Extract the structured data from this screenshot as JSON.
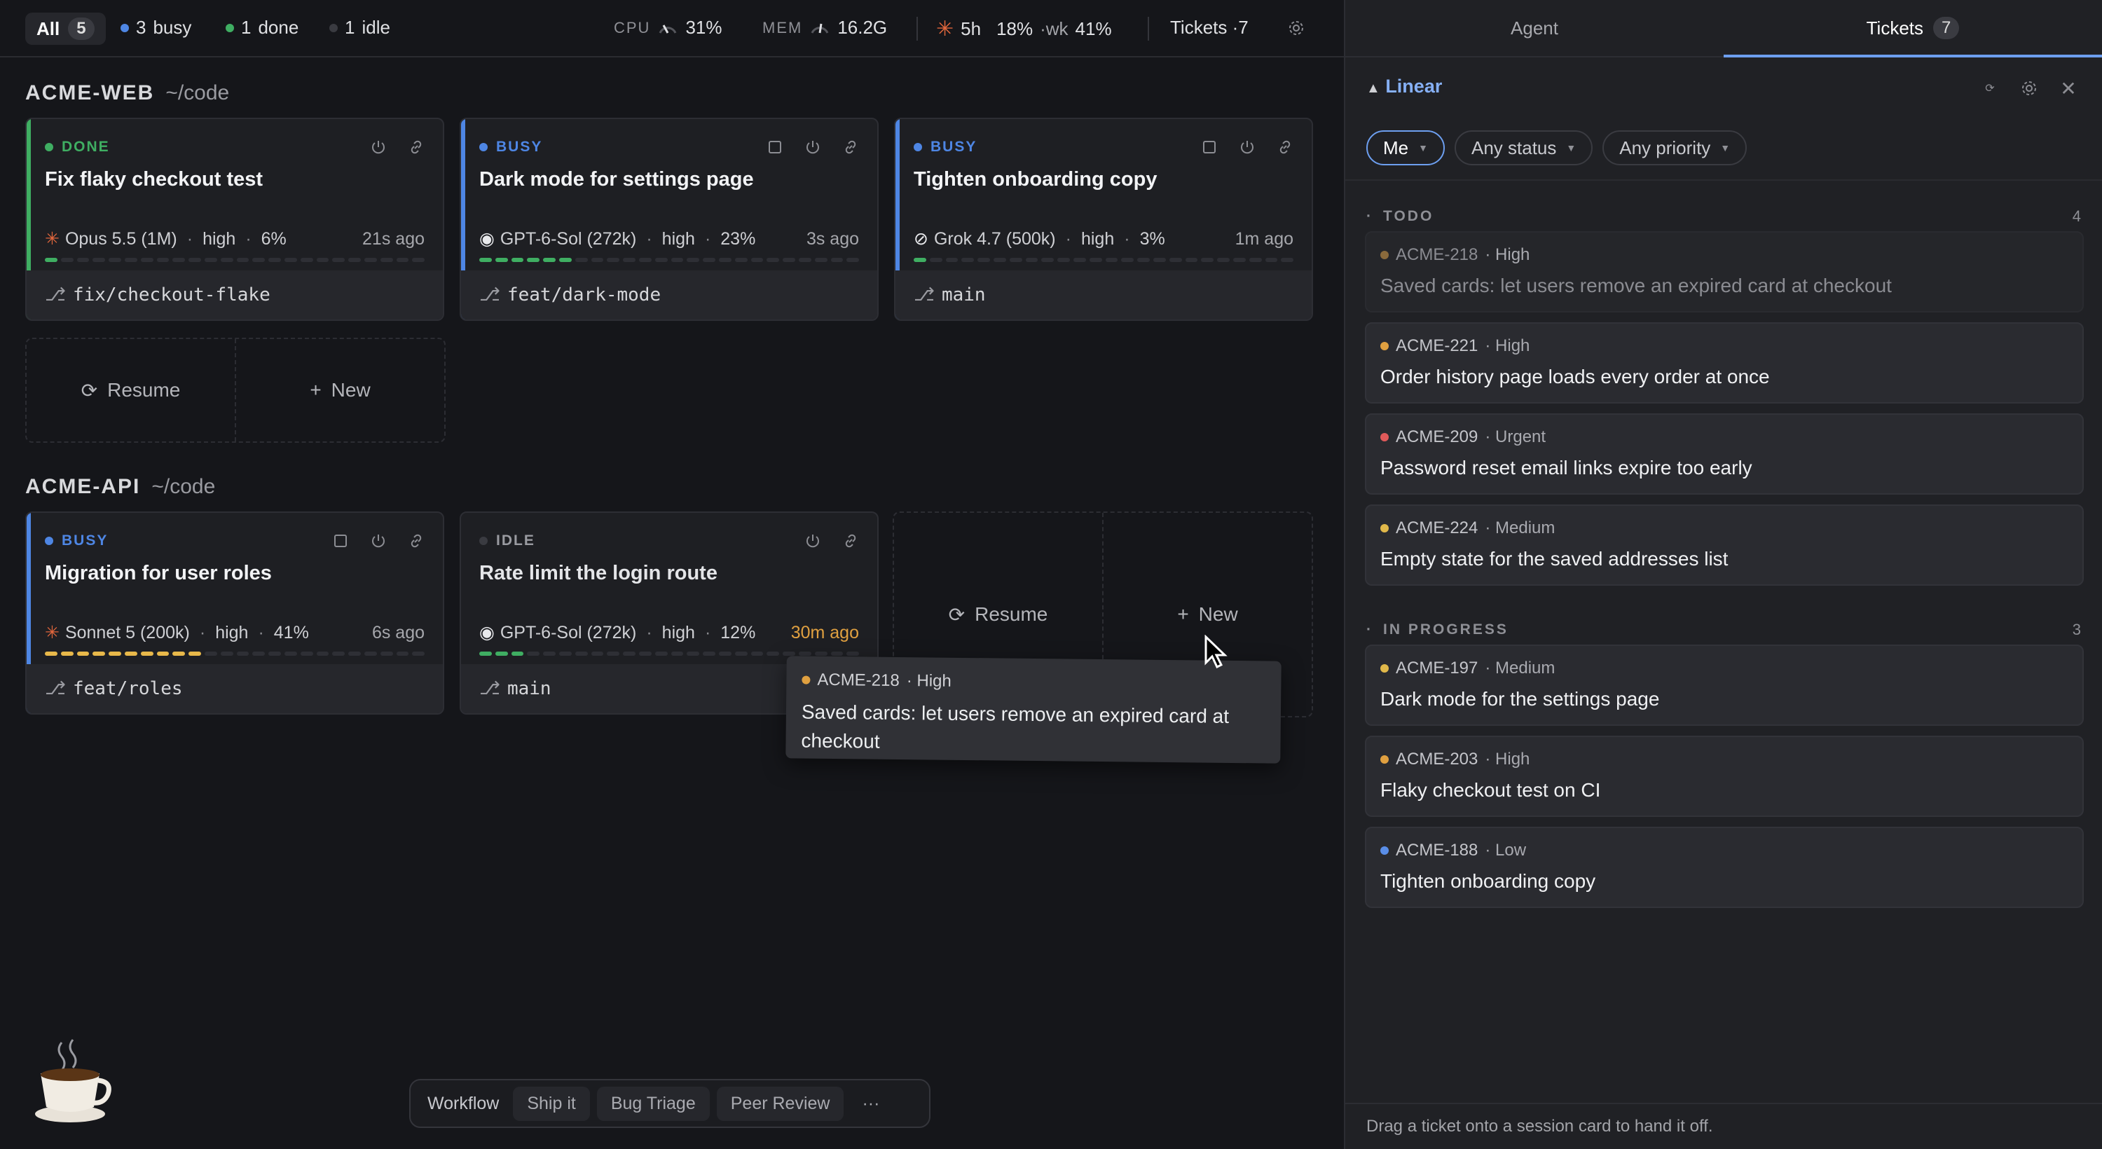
{
  "topbar": {
    "all_label": "All",
    "all_count": "5",
    "busy": {
      "count": "3",
      "label": "busy",
      "color": "#4e86e4"
    },
    "done": {
      "count": "1",
      "label": "done",
      "color": "#3fae62"
    },
    "idle": {
      "count": "1",
      "label": "idle",
      "color": "#55565c"
    },
    "cpu_label": "CPU",
    "cpu_value": "31%",
    "mem_label": "MEM",
    "mem_value": "16.2G",
    "usage_window": "5h",
    "usage_5h": "18%",
    "usage_wk_label": "·wk",
    "usage_wk": "41%",
    "tickets_label": "Tickets ·7"
  },
  "groups": [
    {
      "name": "ACME-WEB",
      "path": "~/code",
      "cards": [
        {
          "status": "DONE",
          "status_color": "#3fae62",
          "title": "Fix flaky checkout test",
          "model": "Opus 5.5 (1M)",
          "effort": "high",
          "percent": "6%",
          "ago": "21s ago",
          "branch": "fix/checkout-flake"
        },
        {
          "status": "BUSY",
          "status_color": "#4e86e4",
          "title": "Dark mode for settings page",
          "model": "GPT-6-Sol (272k)",
          "effort": "high",
          "percent": "23%",
          "ago": "3s ago",
          "branch": "feat/dark-mode"
        },
        {
          "status": "BUSY",
          "status_color": "#4e86e4",
          "title": "Tighten onboarding copy",
          "model": "Grok 4.7 (500k)",
          "effort": "high",
          "percent": "3%",
          "ago": "1m ago",
          "branch": "main"
        }
      ]
    },
    {
      "name": "ACME-API",
      "path": "~/code",
      "cards": [
        {
          "status": "BUSY",
          "status_color": "#4e86e4",
          "title": "Migration for user roles",
          "model": "Sonnet 5 (200k)",
          "effort": "high",
          "percent": "41%",
          "ago": "6s ago",
          "branch": "feat/roles"
        },
        {
          "status": "IDLE",
          "status_color": "#55565c",
          "title": "Rate limit the login route",
          "model": "GPT-6-Sol (272k)",
          "effort": "high",
          "percent": "12%",
          "ago": "30m ago",
          "branch": "main"
        }
      ]
    }
  ],
  "ghost_actions": {
    "resume": "Resume",
    "new": "New"
  },
  "drag_ghost": {
    "id": "ACME-218",
    "priority": "· High",
    "title": "Saved cards: let users remove an expired card at checkout"
  },
  "bottombar": {
    "workflow": "Workflow",
    "chips": [
      "Ship it",
      "Bug Triage",
      "Peer Review"
    ],
    "more": "···"
  },
  "panel": {
    "tabs": [
      {
        "label": "Agent"
      },
      {
        "label": "Tickets",
        "count": "7"
      }
    ],
    "source": "Linear",
    "filters": [
      "Me",
      "Any status",
      "Any priority"
    ],
    "todo": {
      "label": "TODO",
      "count": "4",
      "tickets": [
        {
          "id": "ACME-218",
          "priority": "· High",
          "title": "Saved cards: let users remove an expired card at checkout",
          "color": "#8a6a3c"
        },
        {
          "id": "ACME-221",
          "priority": "· High",
          "title": "Order history page loads every order at once",
          "color": "#e0a040"
        },
        {
          "id": "ACME-209",
          "priority": "· Urgent",
          "title": "Password reset email links expire too early",
          "color": "#e05a5a"
        },
        {
          "id": "ACME-224",
          "priority": "· Medium",
          "title": "Empty state for the saved addresses list",
          "color": "#e0b84a"
        }
      ]
    },
    "in_progress": {
      "label": "IN PROGRESS",
      "count": "3",
      "tickets": [
        {
          "id": "ACME-197",
          "priority": "· Medium",
          "title": "Dark mode for the settings page",
          "color": "#e0b84a"
        },
        {
          "id": "ACME-203",
          "priority": "· High",
          "title": "Flaky checkout test on CI",
          "color": "#e0a040"
        },
        {
          "id": "ACME-188",
          "priority": "· Low",
          "title": "Tighten onboarding copy",
          "color": "#5a8ee8"
        }
      ]
    },
    "footnote": "Drag a ticket onto a session card to hand it off."
  }
}
